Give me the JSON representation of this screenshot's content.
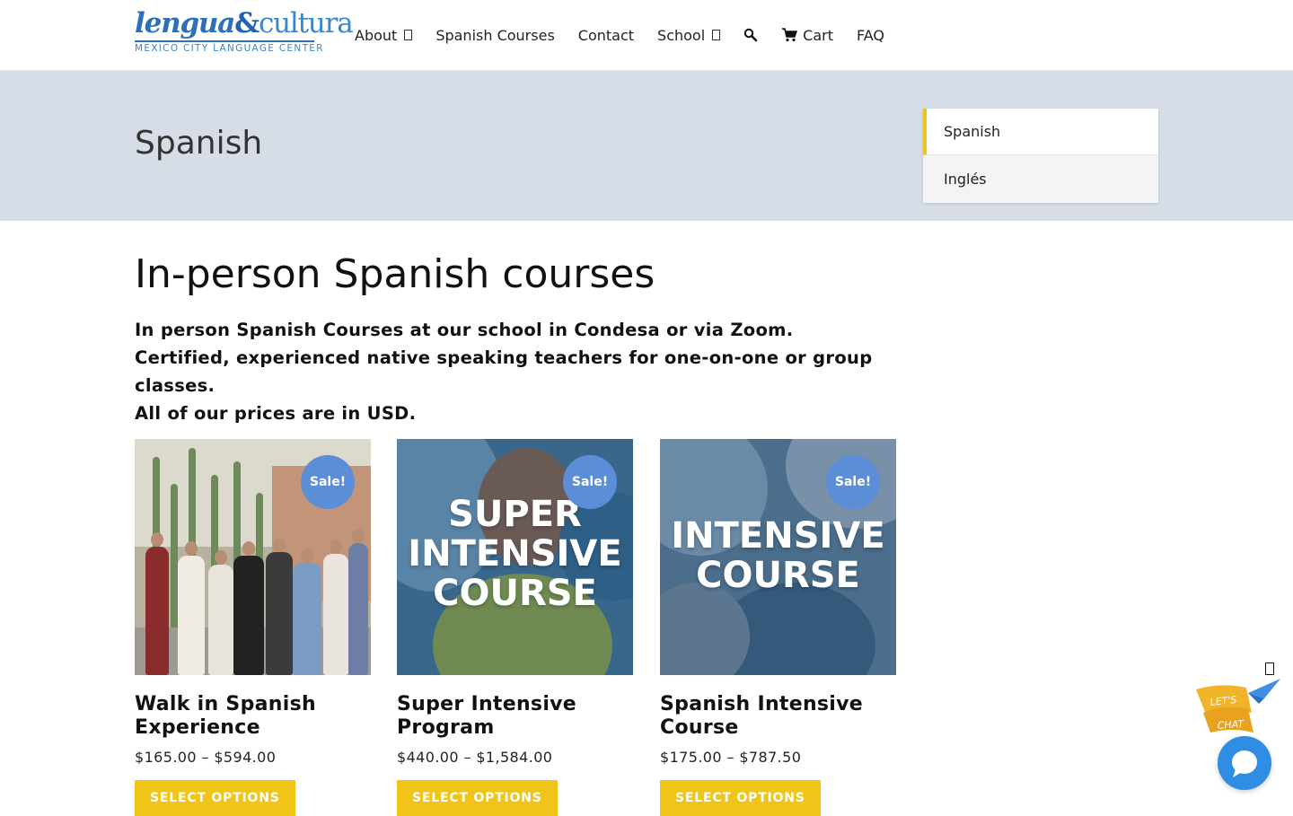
{
  "header": {
    "logo": {
      "word1": "lengua",
      "amp": "&",
      "word2": "cultura",
      "tagline": "MEXICO CITY LANGUAGE CENTER"
    },
    "nav": {
      "about": "About",
      "spanish_courses": "Spanish Courses",
      "contact": "Contact",
      "school": "School",
      "search_icon": "search-icon",
      "cart": "Cart",
      "faq": "FAQ"
    }
  },
  "banner": {
    "title": "Spanish",
    "languages": [
      "Spanish",
      "Inglés"
    ]
  },
  "main": {
    "heading": "In-person Spanish courses",
    "intro": [
      "In person Spanish Courses at our school in Condesa or via Zoom.",
      "Certified, experienced native speaking teachers for one-on-one or group classes.",
      "All of our prices are in USD."
    ]
  },
  "products": [
    {
      "name": "Walk in Spanish Experience",
      "price": "$165.00 – $594.00",
      "badge": "Sale!",
      "button": "SELECT OPTIONS"
    },
    {
      "name": "Super Intensive Program",
      "price": "$440.00 – $1,584.00",
      "badge": "Sale!",
      "button": "SELECT OPTIONS",
      "image_text": [
        "SUPER",
        "INTENSIVE",
        "COURSE"
      ]
    },
    {
      "name": "Spanish Intensive Course",
      "price": "$175.00 – $787.50",
      "badge": "Sale!",
      "button": "SELECT OPTIONS",
      "image_text": [
        "INTENSIVE",
        "COURSE"
      ]
    }
  ],
  "chat": {
    "badge_text": [
      "LET'S",
      "CHAT"
    ]
  },
  "colors": {
    "accent_yellow": "#f0c419",
    "sale_blue": "#5c8ed8",
    "banner_bg": "#d6dde6",
    "brand_blue": "#2b6fbd",
    "chat_blue": "#2f8ee3"
  }
}
